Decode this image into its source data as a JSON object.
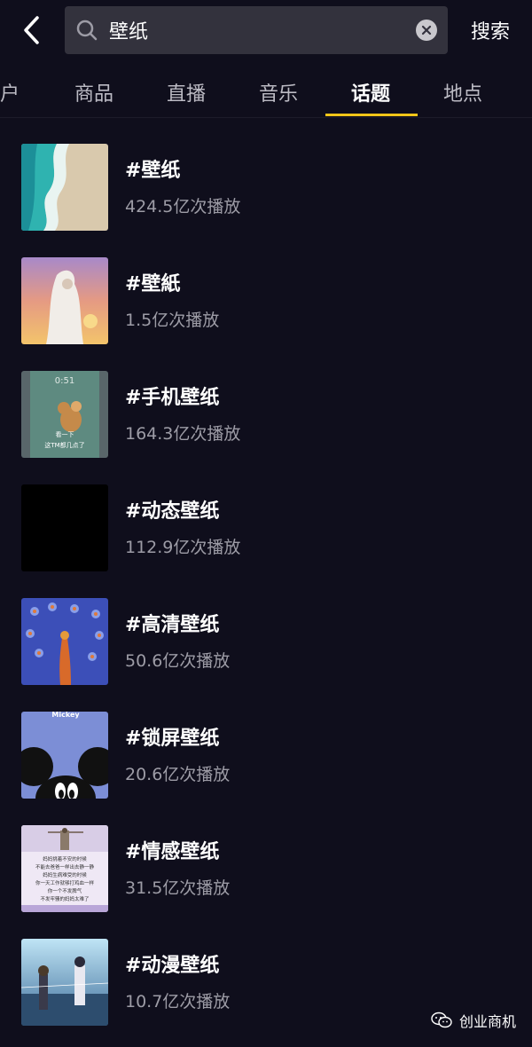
{
  "search": {
    "value": "壁纸",
    "button_label": "搜索"
  },
  "tabs": [
    {
      "label": "户",
      "active": false
    },
    {
      "label": "商品",
      "active": false
    },
    {
      "label": "直播",
      "active": false
    },
    {
      "label": "音乐",
      "active": false
    },
    {
      "label": "话题",
      "active": true
    },
    {
      "label": "地点",
      "active": false
    }
  ],
  "topics": [
    {
      "name": "#壁纸",
      "plays": "424.5亿次播放"
    },
    {
      "name": "#壁紙",
      "plays": "1.5亿次播放"
    },
    {
      "name": "#手机壁纸",
      "plays": "164.3亿次播放"
    },
    {
      "name": "#动态壁纸",
      "plays": "112.9亿次播放"
    },
    {
      "name": "#高清壁纸",
      "plays": "50.6亿次播放"
    },
    {
      "name": "#锁屏壁纸",
      "plays": "20.6亿次播放"
    },
    {
      "name": "#情感壁纸",
      "plays": "31.5亿次播放"
    },
    {
      "name": "#动漫壁纸",
      "plays": "10.7亿次播放"
    }
  ],
  "thumbnails": {
    "t3_time": "0:51",
    "t3_caption1": "看一下",
    "t3_caption2": "这TM都几点了",
    "t6_title": "Mickey",
    "t7_lines": [
      "妈妈挑着不安的时候",
      "不能去爸爸一样出去静一静",
      "妈妈生病难受的时候",
      "你一天工作就够打鸡血一样",
      "你一个不发脾气",
      "不发牢骚的妈妈太难了"
    ]
  },
  "watermark": {
    "text": "创业商机"
  },
  "colors": {
    "background": "#0f0e1c",
    "accent": "#f5c518",
    "search_bg": "#33323d"
  }
}
